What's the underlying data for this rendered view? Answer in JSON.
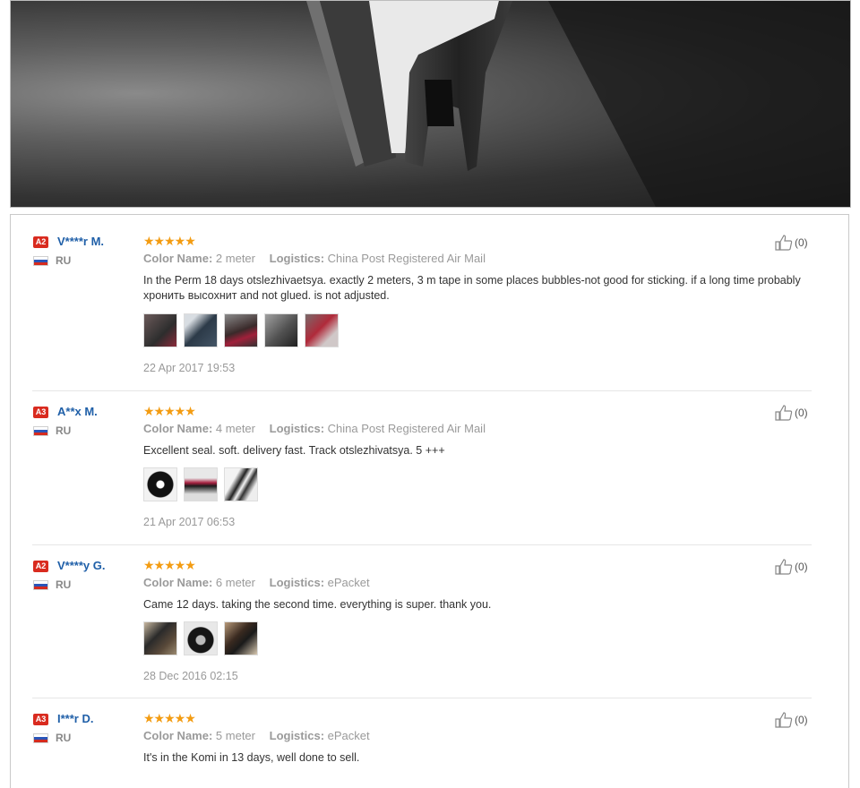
{
  "hero": {
    "image": "door-seal-rubber-strip-closeup"
  },
  "reviews": [
    {
      "level": "A2",
      "name": "V****r M.",
      "country": "RU",
      "stars": "★★★★★",
      "color_label": "Color Name:",
      "color_value": "2 meter",
      "logistics_label": "Logistics:",
      "logistics_value": "China Post Registered Air Mail",
      "text": "In the Perm 18 days otslezhivaetsya. exactly 2 meters, 3 m tape in some places bubbles-not good for sticking. if a long time probably хронить высохнит and not glued. is not adjusted.",
      "photos": 5,
      "date": "22 Apr 2017 19:53",
      "helpful": "(0)"
    },
    {
      "level": "A3",
      "name": "A**x M.",
      "country": "RU",
      "stars": "★★★★★",
      "color_label": "Color Name:",
      "color_value": "4 meter",
      "logistics_label": "Logistics:",
      "logistics_value": "China Post Registered Air Mail",
      "text": "Excellent seal. soft. delivery fast. Track otslezhivatsya. 5 +++",
      "photos": 3,
      "date": "21 Apr 2017 06:53",
      "helpful": "(0)"
    },
    {
      "level": "A2",
      "name": "V****y G.",
      "country": "RU",
      "stars": "★★★★★",
      "color_label": "Color Name:",
      "color_value": "6 meter",
      "logistics_label": "Logistics:",
      "logistics_value": "ePacket",
      "text": "Came 12 days. taking the second time. everything is super. thank you.",
      "photos": 3,
      "date": "28 Dec 2016 02:15",
      "helpful": "(0)"
    },
    {
      "level": "A3",
      "name": "I***r D.",
      "country": "RU",
      "stars": "★★★★★",
      "color_label": "Color Name:",
      "color_value": "5 meter",
      "logistics_label": "Logistics:",
      "logistics_value": "ePacket",
      "text": "It's in the Komi in 13 days, well done to sell.",
      "photos": 0,
      "date": "",
      "helpful": "(0)"
    }
  ]
}
